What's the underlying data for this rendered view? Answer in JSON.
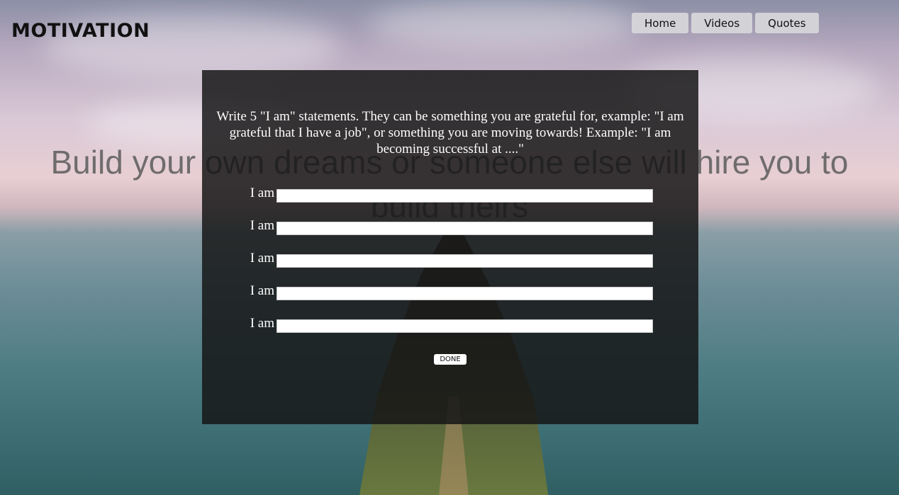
{
  "header": {
    "logo": "MOTIVATION",
    "nav": [
      {
        "label": "Home"
      },
      {
        "label": "Videos"
      },
      {
        "label": "Quotes"
      }
    ]
  },
  "hero": {
    "quote": "Build your own dreams or someone else will hire you to build theirs"
  },
  "modal": {
    "instructions": "Write 5 \"I am\" statements. They can be something you are grateful for, example: \"I am grateful that I have a job\", or something you are moving towards! Example: \"I am becoming successful at ....\"",
    "rows": [
      {
        "label": "I am",
        "value": ""
      },
      {
        "label": "I am",
        "value": ""
      },
      {
        "label": "I am",
        "value": ""
      },
      {
        "label": "I am",
        "value": ""
      },
      {
        "label": "I am",
        "value": ""
      }
    ],
    "done_label": "DONE"
  },
  "colors": {
    "modal_bg": "#141414",
    "nav_bg": "#d7d7da",
    "text_on_modal": "#ffffff"
  }
}
